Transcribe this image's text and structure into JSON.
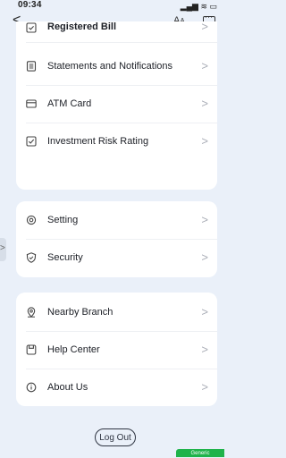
{
  "status_bar": {
    "time": "09:34",
    "icons_text": "▂▄▆ ≋ ▭"
  },
  "nav": {
    "back_label": "<",
    "font_size_label_big": "A",
    "font_size_label_small": "A"
  },
  "group1": {
    "items": [
      {
        "label": "Registered Bill",
        "icon": "checkbox-icon"
      },
      {
        "label": "Statements and Notifications",
        "icon": "document-icon"
      },
      {
        "label": "ATM Card",
        "icon": "card-icon"
      },
      {
        "label": "Investment Risk Rating",
        "icon": "rating-icon"
      }
    ]
  },
  "group2": {
    "items": [
      {
        "label": "Setting",
        "icon": "gear-icon"
      },
      {
        "label": "Security",
        "icon": "shield-icon"
      }
    ]
  },
  "group3": {
    "items": [
      {
        "label": "Nearby Branch",
        "icon": "location-icon"
      },
      {
        "label": "Help Center",
        "icon": "help-center-icon"
      },
      {
        "label": "About Us",
        "icon": "info-icon"
      }
    ]
  },
  "chevron": ">",
  "side_tab_label": ">",
  "logout_label": "Log Out",
  "green_tag_label": "Generic",
  "colors": {
    "background": "#eaf0f9",
    "card": "#ffffff",
    "accent_green": "#1fb34b"
  }
}
